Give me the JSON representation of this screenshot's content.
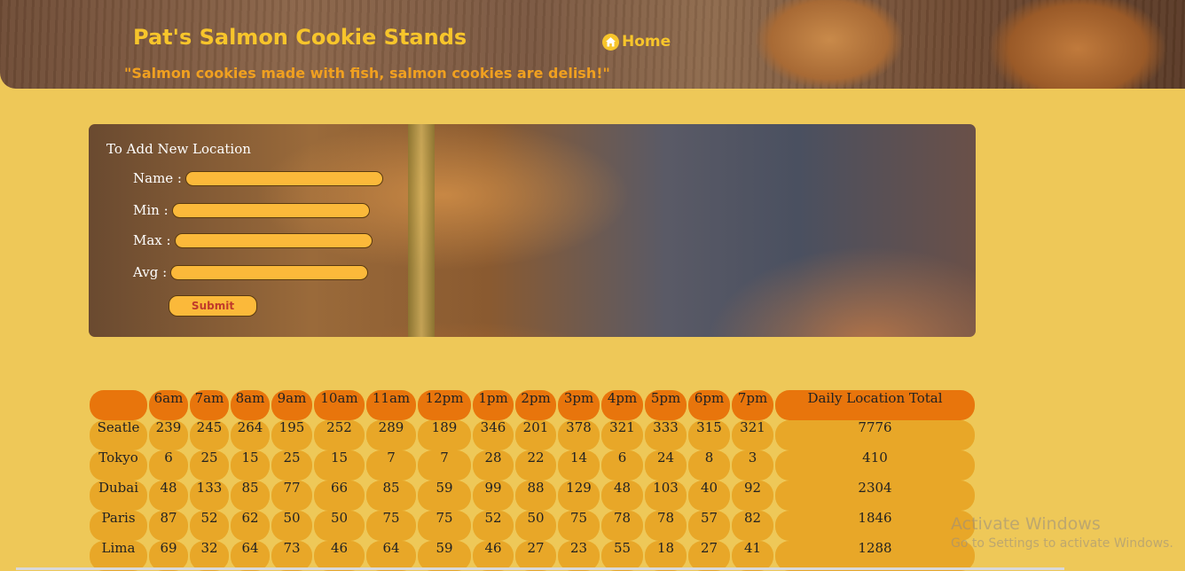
{
  "header": {
    "title": "Pat's Salmon Cookie Stands",
    "tagline": "\"Salmon cookies made with fish, salmon cookies are delish!\"",
    "home_label": "Home",
    "home_icon": "home-icon"
  },
  "form": {
    "legend": "To Add New Location",
    "fields": [
      {
        "label": "Name :",
        "value": ""
      },
      {
        "label": "Min :",
        "value": ""
      },
      {
        "label": "Max :",
        "value": ""
      },
      {
        "label": "Avg :",
        "value": ""
      }
    ],
    "submit_label": "Submit"
  },
  "table": {
    "headers": [
      "",
      "6am",
      "7am",
      "8am",
      "9am",
      "10am",
      "11am",
      "12pm",
      "1pm",
      "2pm",
      "3pm",
      "4pm",
      "5pm",
      "6pm",
      "7pm",
      "Daily Location Total"
    ],
    "rows": [
      {
        "location": "Seatle",
        "values": [
          "239",
          "245",
          "264",
          "195",
          "252",
          "289",
          "189",
          "346",
          "201",
          "378",
          "321",
          "333",
          "315",
          "321"
        ],
        "total": "7776"
      },
      {
        "location": "Tokyo",
        "values": [
          "6",
          "25",
          "15",
          "25",
          "15",
          "7",
          "7",
          "28",
          "22",
          "14",
          "6",
          "24",
          "8",
          "3"
        ],
        "total": "410"
      },
      {
        "location": "Dubai",
        "values": [
          "48",
          "133",
          "85",
          "77",
          "66",
          "85",
          "59",
          "99",
          "88",
          "129",
          "48",
          "103",
          "40",
          "92"
        ],
        "total": "2304"
      },
      {
        "location": "Paris",
        "values": [
          "87",
          "52",
          "62",
          "50",
          "50",
          "75",
          "75",
          "52",
          "50",
          "75",
          "78",
          "78",
          "57",
          "82"
        ],
        "total": "1846"
      },
      {
        "location": "Lima",
        "values": [
          "69",
          "32",
          "64",
          "73",
          "46",
          "64",
          "59",
          "46",
          "27",
          "23",
          "55",
          "18",
          "27",
          "41"
        ],
        "total": "1288"
      }
    ]
  },
  "watermark": {
    "title": "Activate Windows",
    "subtitle": "Go to Settings to activate Windows."
  },
  "colors": {
    "page_bg": "#eec858",
    "title": "#f7c52b",
    "tagline": "#f0a020",
    "input_bg": "#fbb93a",
    "submit_text": "#c0392b",
    "header_row": "#e8750c",
    "body_row": "#e8a728"
  }
}
